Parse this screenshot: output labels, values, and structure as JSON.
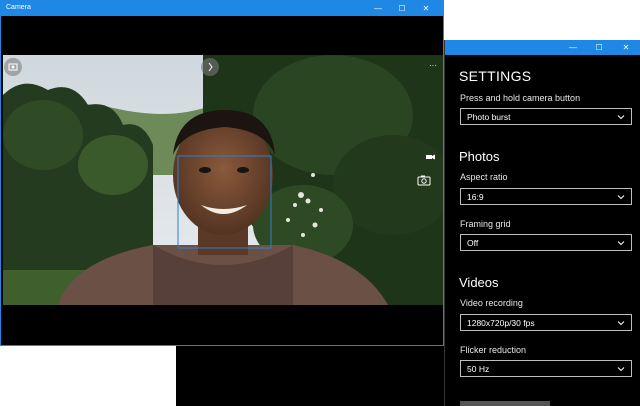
{
  "camera_window": {
    "title": "Camera",
    "minimize_glyph": "—",
    "maximize_glyph": "☐",
    "close_glyph": "✕",
    "top_right_glyph": "···"
  },
  "settings_window": {
    "minimize_glyph": "—",
    "maximize_glyph": "☐",
    "close_glyph": "✕",
    "heading": "SETTINGS",
    "press_hold": {
      "label": "Press and hold camera button",
      "value": "Photo burst"
    },
    "photos_heading": "Photos",
    "aspect_ratio": {
      "label": "Aspect ratio",
      "value": "16:9"
    },
    "framing_grid": {
      "label": "Framing grid",
      "value": "Off"
    },
    "videos_heading": "Videos",
    "video_recording": {
      "label": "Video recording",
      "value": "1280x720p/30 fps"
    },
    "flicker_reduction": {
      "label": "Flicker reduction",
      "value": "50 Hz"
    }
  },
  "icons": {
    "left_overlay": "camera-roll-icon",
    "top_overlay": "photo-timer-icon",
    "right_small": "video-mode-icon",
    "right_camera": "camera-icon",
    "combo_arrow": "chevron-down-icon"
  },
  "colors": {
    "accent": "#1f88e5",
    "face_box": "#2f7fc9"
  }
}
